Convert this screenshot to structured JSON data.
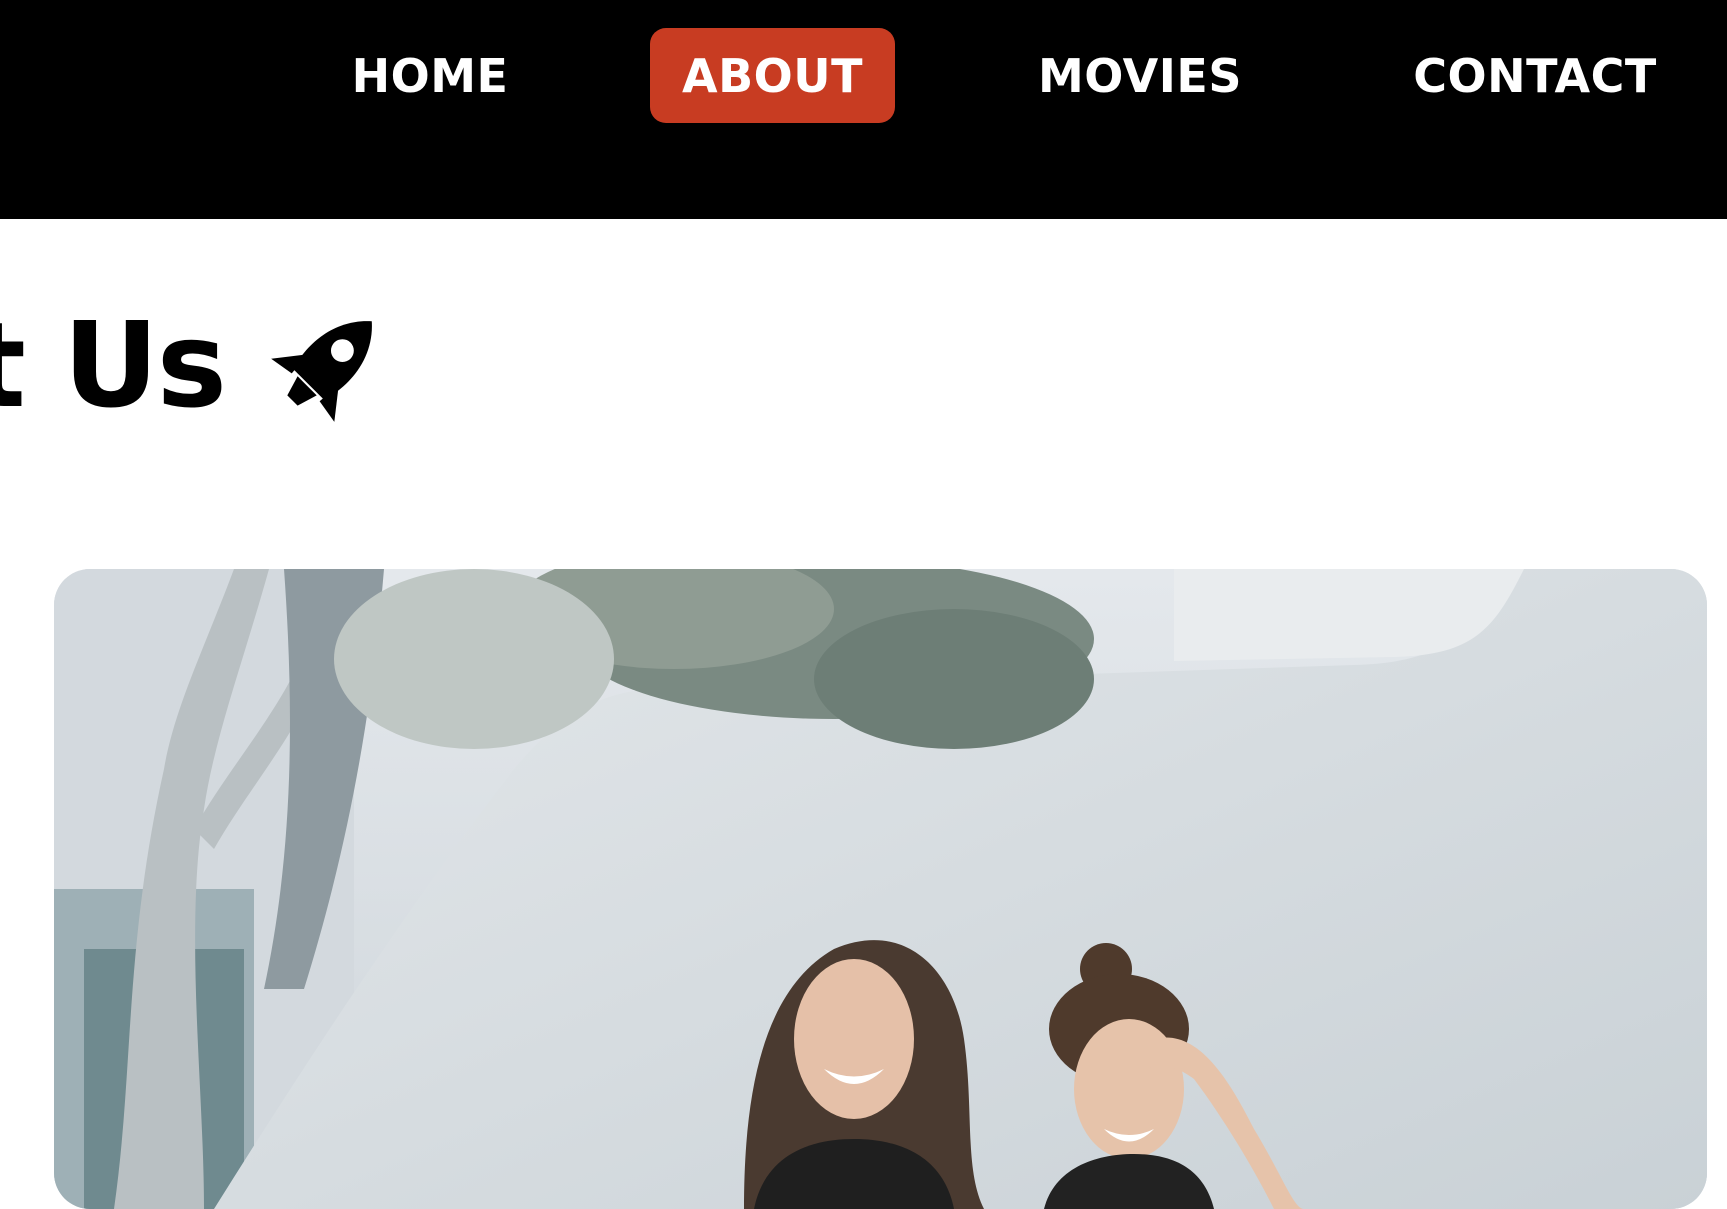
{
  "nav": {
    "items": [
      {
        "label": "HOME",
        "active": false
      },
      {
        "label": "ABOUT",
        "active": true
      },
      {
        "label": "MOVIES",
        "active": false
      },
      {
        "label": "CONTACT",
        "active": false
      }
    ],
    "active_color": "#c83c22",
    "background_color": "#000000",
    "text_color": "#ffffff"
  },
  "page": {
    "title_visible": "t Us",
    "title_icon": "rocket-icon"
  },
  "hero": {
    "image_subject": "two laughing women seated before a white wall under an olive tree",
    "icon": "photo"
  }
}
